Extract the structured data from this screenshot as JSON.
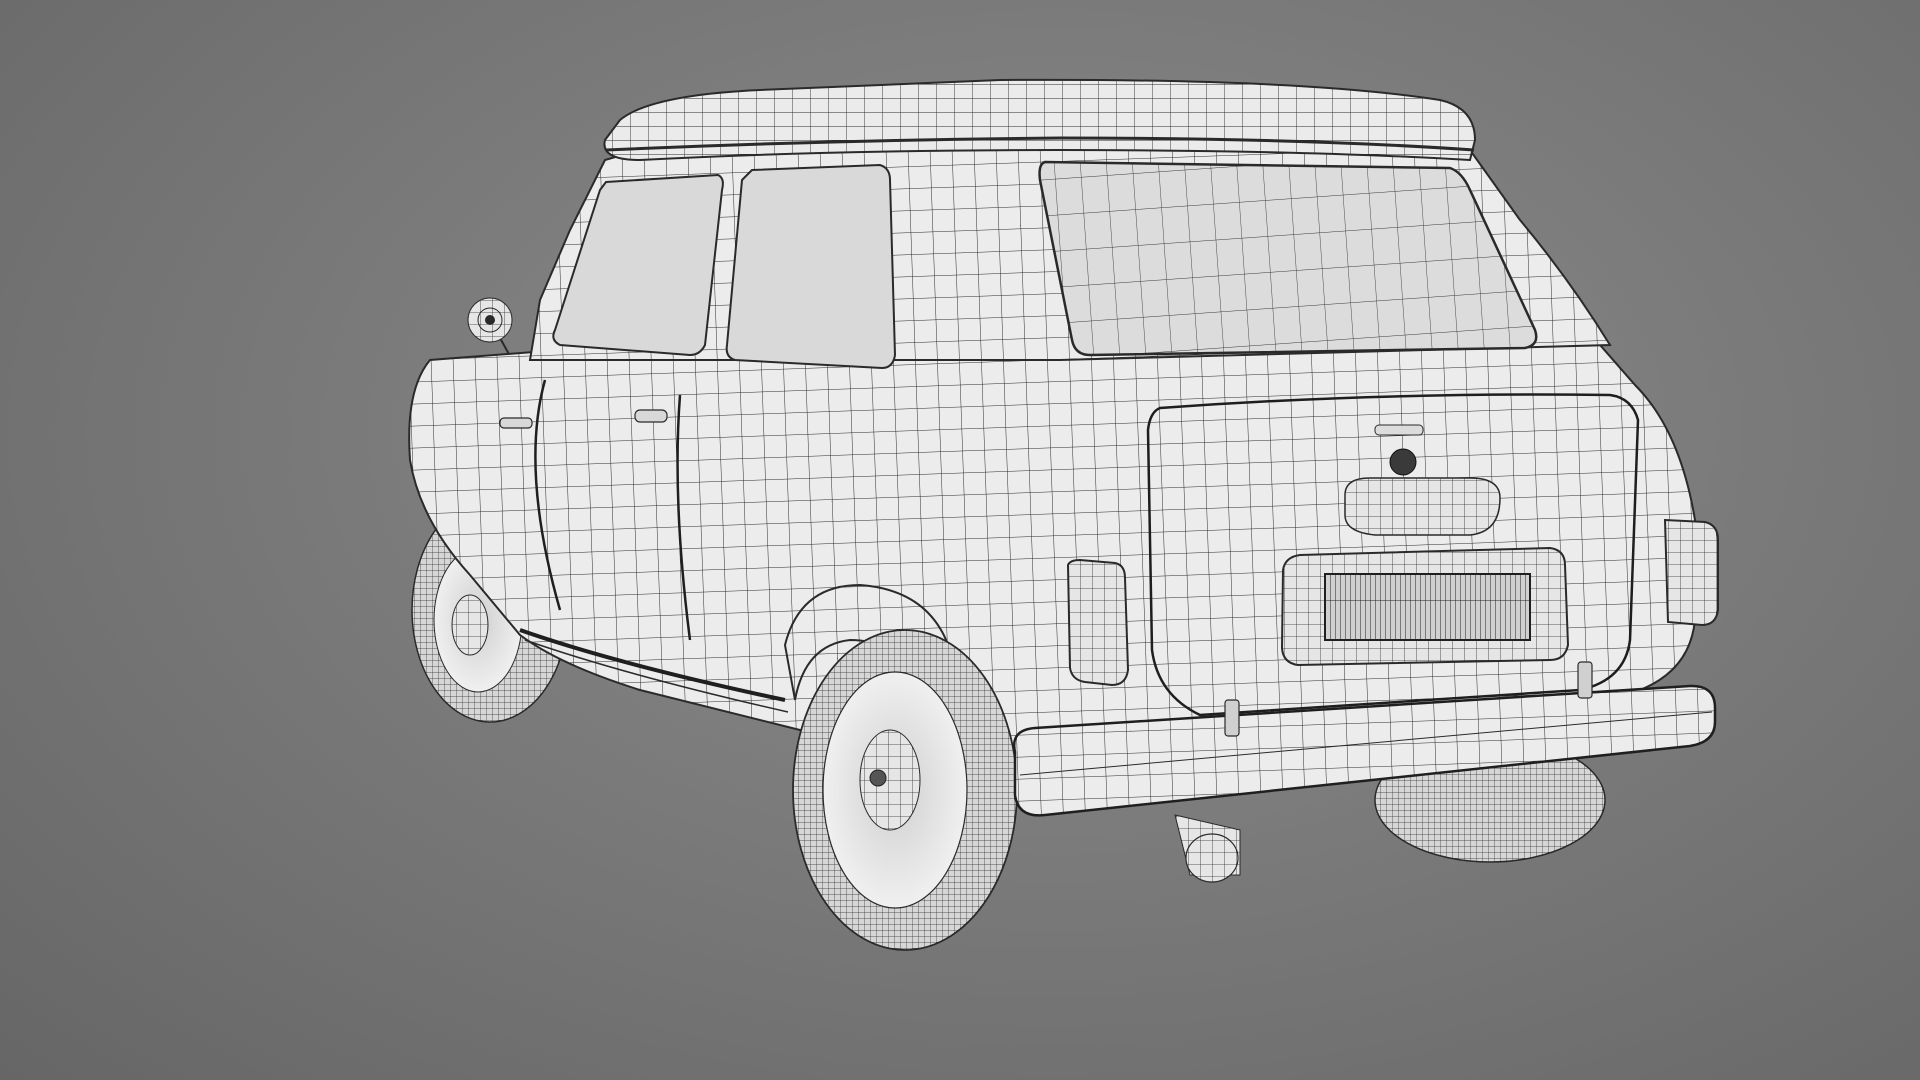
{
  "scene": {
    "subject": "car-wireframe-render",
    "view": "rear-three-quarter",
    "colors": {
      "background": "#7b7b7b",
      "surface": "#ececec",
      "glass": "#d9d9d9",
      "wire": "#2a2a2a",
      "tire": "#cfcfcf",
      "shadow": "#9a9a9a"
    }
  }
}
